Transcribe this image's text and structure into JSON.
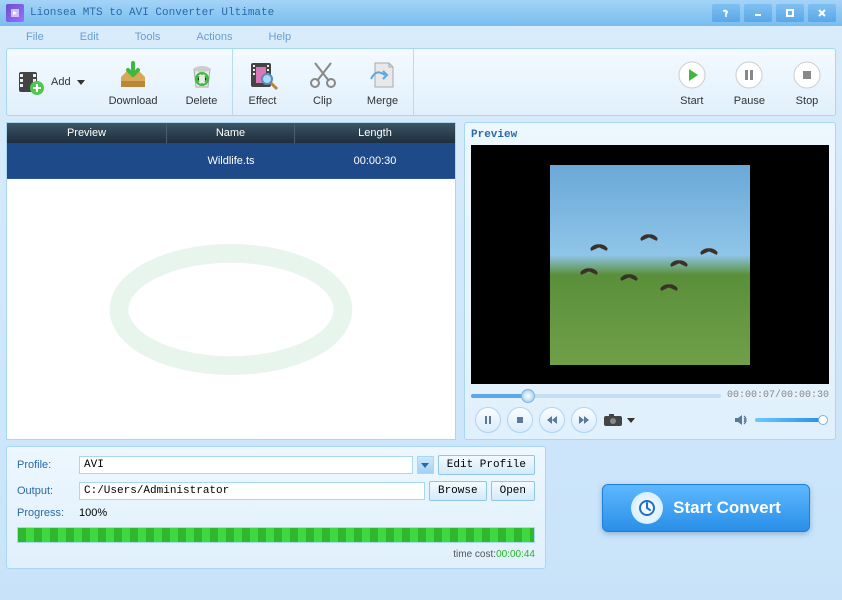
{
  "window": {
    "title": "Lionsea MTS to AVI Converter Ultimate"
  },
  "menu": {
    "file": "File",
    "edit": "Edit",
    "tools": "Tools",
    "actions": "Actions",
    "help": "Help"
  },
  "toolbar": {
    "add": "Add",
    "download": "Download",
    "delete": "Delete",
    "effect": "Effect",
    "clip": "Clip",
    "merge": "Merge",
    "start": "Start",
    "pause": "Pause",
    "stop": "Stop"
  },
  "listHeader": {
    "preview": "Preview",
    "name": "Name",
    "length": "Length"
  },
  "files": [
    {
      "name": "Wildlife.ts",
      "length": "00:00:30"
    }
  ],
  "preview": {
    "title": "Preview",
    "time": "00:00:07/00:00:30"
  },
  "profile": {
    "label": "Profile:",
    "value": "AVI",
    "editBtn": "Edit Profile"
  },
  "output": {
    "label": "Output:",
    "value": "C:/Users/Administrator",
    "browse": "Browse",
    "open": "Open"
  },
  "progress": {
    "label": "Progress:",
    "value": "100%",
    "timeCostLabel": "time cost:",
    "timeCostValue": "00:00:44"
  },
  "startConvert": "Start Convert"
}
